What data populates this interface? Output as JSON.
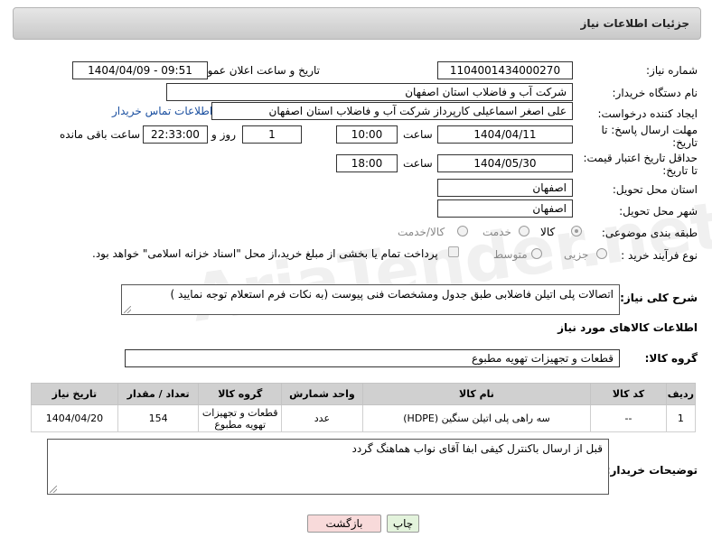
{
  "header": {
    "title": "جزئیات اطلاعات نیاز"
  },
  "fields": {
    "need_number_label": "شماره نیاز:",
    "need_number": "1104001434000270",
    "announce_label": "تاریخ و ساعت اعلان عمومی:",
    "announce_value": "1404/04/09 - 09:51",
    "buyer_org_label": "نام دستگاه خریدار:",
    "buyer_org": "شرکت آب و فاضلاب استان اصفهان",
    "requester_label": "ایجاد کننده درخواست:",
    "requester": "علی اصغر اسماعیلی کارپرداز شرکت آب و فاضلاب استان اصفهان",
    "contact_link": "اطلاعات تماس خریدار",
    "deadline_label_1": "مهلت ارسال پاسخ: تا",
    "deadline_label_2": "تاریخ:",
    "deadline_date": "1404/04/11",
    "time_label": "ساعت",
    "deadline_time": "10:00",
    "days_value": "1",
    "days_label": "روز و",
    "remaining_time": "22:33:00",
    "remaining_label": "ساعت باقی مانده",
    "price_validity_label_1": "حداقل تاریخ اعتبار قیمت:",
    "price_validity_label_2": "تا تاریخ:",
    "price_validity_date": "1404/05/30",
    "price_validity_time": "18:00",
    "province_label": "استان محل تحویل:",
    "province": "اصفهان",
    "city_label": "شهر محل تحویل:",
    "city": "اصفهان",
    "category_label": "طبقه بندی موضوعی:",
    "category_options": [
      "کالا",
      "خدمت",
      "کالا/خدمت"
    ],
    "process_label": "نوع فرآیند خرید :",
    "process_options": [
      "جزیی",
      "متوسط"
    ],
    "payment_note": "پرداخت تمام یا بخشی از مبلغ خرید،از محل \"اسناد خزانه اسلامی\" خواهد بود."
  },
  "description": {
    "label": "شرح کلی نیاز:",
    "text": "اتصالات پلی اتیلن فاضلابی طبق جدول ومشخصات فنی پیوست (به نکات فرم استعلام توجه نمایید )"
  },
  "goods_section": {
    "title": "اطلاعات کالاهای مورد نیاز",
    "group_label": "گروه کالا:",
    "group_value": "قطعات و تجهیزات تهویه مطبوع"
  },
  "table": {
    "headers": [
      "ردیف",
      "کد کالا",
      "نام کالا",
      "واحد شمارش",
      "گروه کالا",
      "تعداد / مقدار",
      "تاریخ نیاز"
    ],
    "rows": [
      [
        "1",
        "--",
        "سه راهی پلی اتیلن سنگین (HDPE)",
        "عدد",
        "قطعات و تجهیزات تهویه مطبوع",
        "154",
        "1404/04/20"
      ]
    ]
  },
  "buyer_notes": {
    "label": "توضیحات خریدار:",
    "text": "قبل از ارسال باکنترل کیفی ابفا آقای نواب هماهنگ گردد"
  },
  "buttons": {
    "print": "چاپ",
    "back": "بازگشت"
  },
  "watermark": "AriaTender.net",
  "colors": {
    "link": "#1a4fa0",
    "print_bg": "#e3f3dc",
    "back_bg": "#f8dada"
  }
}
